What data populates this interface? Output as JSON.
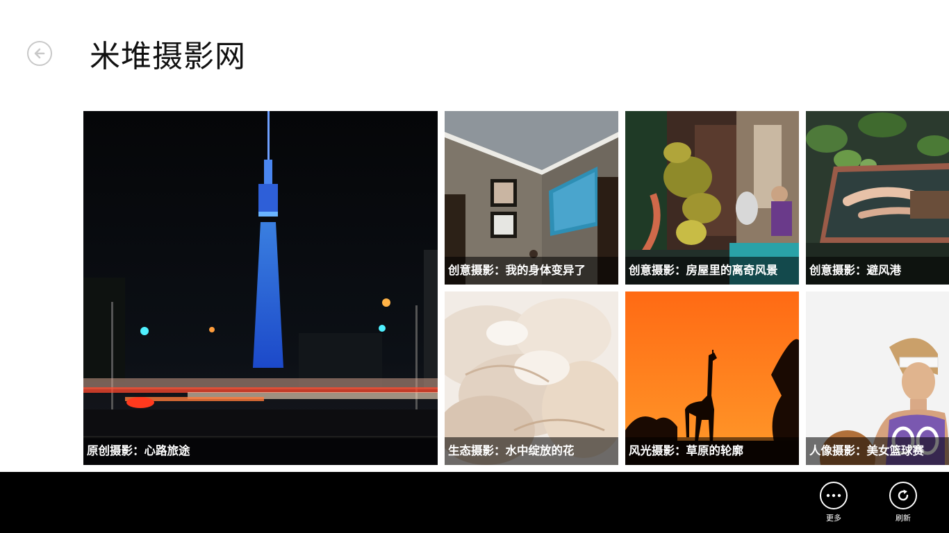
{
  "header": {
    "title": "米堆摄影网"
  },
  "tiles": [
    {
      "caption": "原创摄影：心路旅途",
      "icon": "tokyo-skytree-night"
    },
    {
      "caption": "创意摄影：我的身体变异了",
      "icon": "room-with-frames"
    },
    {
      "caption": "创意摄影：房屋里的离奇风景",
      "icon": "surreal-plants"
    },
    {
      "caption": "创意摄影：避风港",
      "icon": "woman-in-pool"
    },
    {
      "caption": "生态摄影：水中绽放的花",
      "icon": "white-flower"
    },
    {
      "caption": "风光摄影：草原的轮廓",
      "icon": "giraffe-silhouette-sunset"
    },
    {
      "caption": "人像摄影：美女篮球赛",
      "icon": "basketball-woman"
    }
  ],
  "appbar": {
    "more_label": "更多",
    "refresh_label": "刷新"
  },
  "colors": {
    "background": "#ffffff",
    "appbar": "#000000",
    "caption_overlay": "rgba(0,0,0,0.55)"
  }
}
